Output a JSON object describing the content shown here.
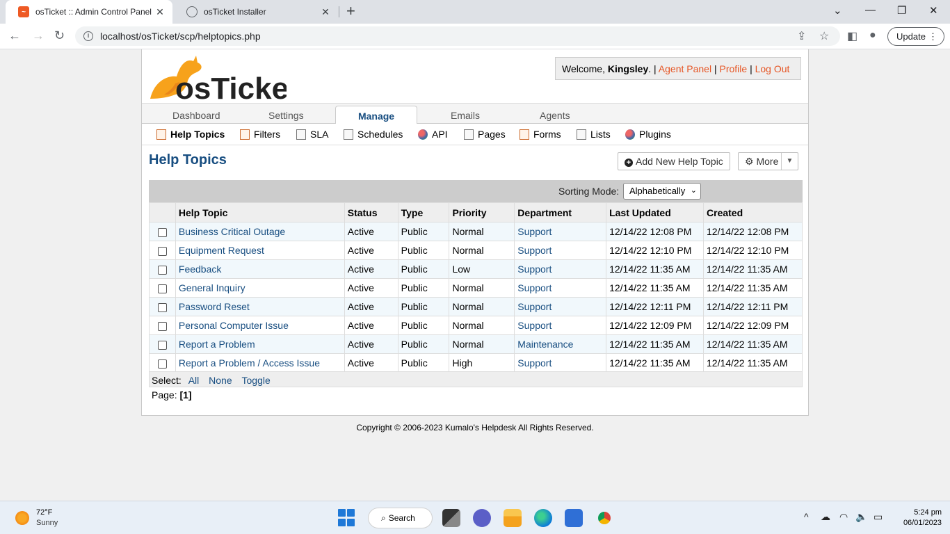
{
  "browser": {
    "tabs": [
      {
        "title": "osTicket :: Admin Control Panel",
        "active": true
      },
      {
        "title": "osTicket Installer",
        "active": false
      }
    ],
    "url": "localhost/osTicket/scp/helptopics.php",
    "update_label": "Update"
  },
  "header": {
    "logo_text": "osTicket",
    "welcome_prefix": "Welcome, ",
    "user_name": "Kingsley",
    "welcome_suffix": ". | ",
    "agent_panel": "Agent Panel",
    "sep1": " | ",
    "profile": "Profile",
    "sep2": " | ",
    "logout": "Log Out"
  },
  "nav": {
    "items": [
      "Dashboard",
      "Settings",
      "Manage",
      "Emails",
      "Agents"
    ],
    "active": "Manage"
  },
  "subnav": {
    "items": [
      "Help Topics",
      "Filters",
      "SLA",
      "Schedules",
      "API",
      "Pages",
      "Forms",
      "Lists",
      "Plugins"
    ],
    "active": "Help Topics"
  },
  "page": {
    "title": "Help Topics",
    "add_button": "Add New Help Topic",
    "more_button": "More",
    "sorting_label": "Sorting Mode:",
    "sorting_value": "Alphabetically"
  },
  "table": {
    "headers": [
      "Help Topic",
      "Status",
      "Type",
      "Priority",
      "Department",
      "Last Updated",
      "Created"
    ],
    "rows": [
      {
        "topic": "Business Critical Outage",
        "status": "Active",
        "type": "Public",
        "priority": "Normal",
        "department": "Support",
        "updated": "12/14/22 12:08 PM",
        "created": "12/14/22 12:08 PM"
      },
      {
        "topic": "Equipment Request",
        "status": "Active",
        "type": "Public",
        "priority": "Normal",
        "department": "Support",
        "updated": "12/14/22 12:10 PM",
        "created": "12/14/22 12:10 PM"
      },
      {
        "topic": "Feedback",
        "status": "Active",
        "type": "Public",
        "priority": "Low",
        "department": "Support",
        "updated": "12/14/22 11:35 AM",
        "created": "12/14/22 11:35 AM"
      },
      {
        "topic": "General Inquiry",
        "status": "Active",
        "type": "Public",
        "priority": "Normal",
        "department": "Support",
        "updated": "12/14/22 11:35 AM",
        "created": "12/14/22 11:35 AM"
      },
      {
        "topic": "Password Reset",
        "status": "Active",
        "type": "Public",
        "priority": "Normal",
        "department": "Support",
        "updated": "12/14/22 12:11 PM",
        "created": "12/14/22 12:11 PM"
      },
      {
        "topic": "Personal Computer Issue",
        "status": "Active",
        "type": "Public",
        "priority": "Normal",
        "department": "Support",
        "updated": "12/14/22 12:09 PM",
        "created": "12/14/22 12:09 PM"
      },
      {
        "topic": "Report a Problem",
        "status": "Active",
        "type": "Public",
        "priority": "Normal",
        "department": "Maintenance",
        "updated": "12/14/22 11:35 AM",
        "created": "12/14/22 11:35 AM"
      },
      {
        "topic": "Report a Problem / Access Issue",
        "status": "Active",
        "type": "Public",
        "priority": "High",
        "department": "Support",
        "updated": "12/14/22 11:35 AM",
        "created": "12/14/22 11:35 AM"
      }
    ]
  },
  "select": {
    "label": "Select:",
    "all": "All",
    "none": "None",
    "toggle": "Toggle"
  },
  "pager": {
    "label": "Page:",
    "current": "[1]"
  },
  "footer": {
    "copyright": "Copyright © 2006-2023 Kumalo's Helpdesk All Rights Reserved."
  },
  "taskbar": {
    "temperature": "72°F",
    "condition": "Sunny",
    "search_label": "Search",
    "time": "5:24 pm",
    "date": "06/01/2023"
  }
}
